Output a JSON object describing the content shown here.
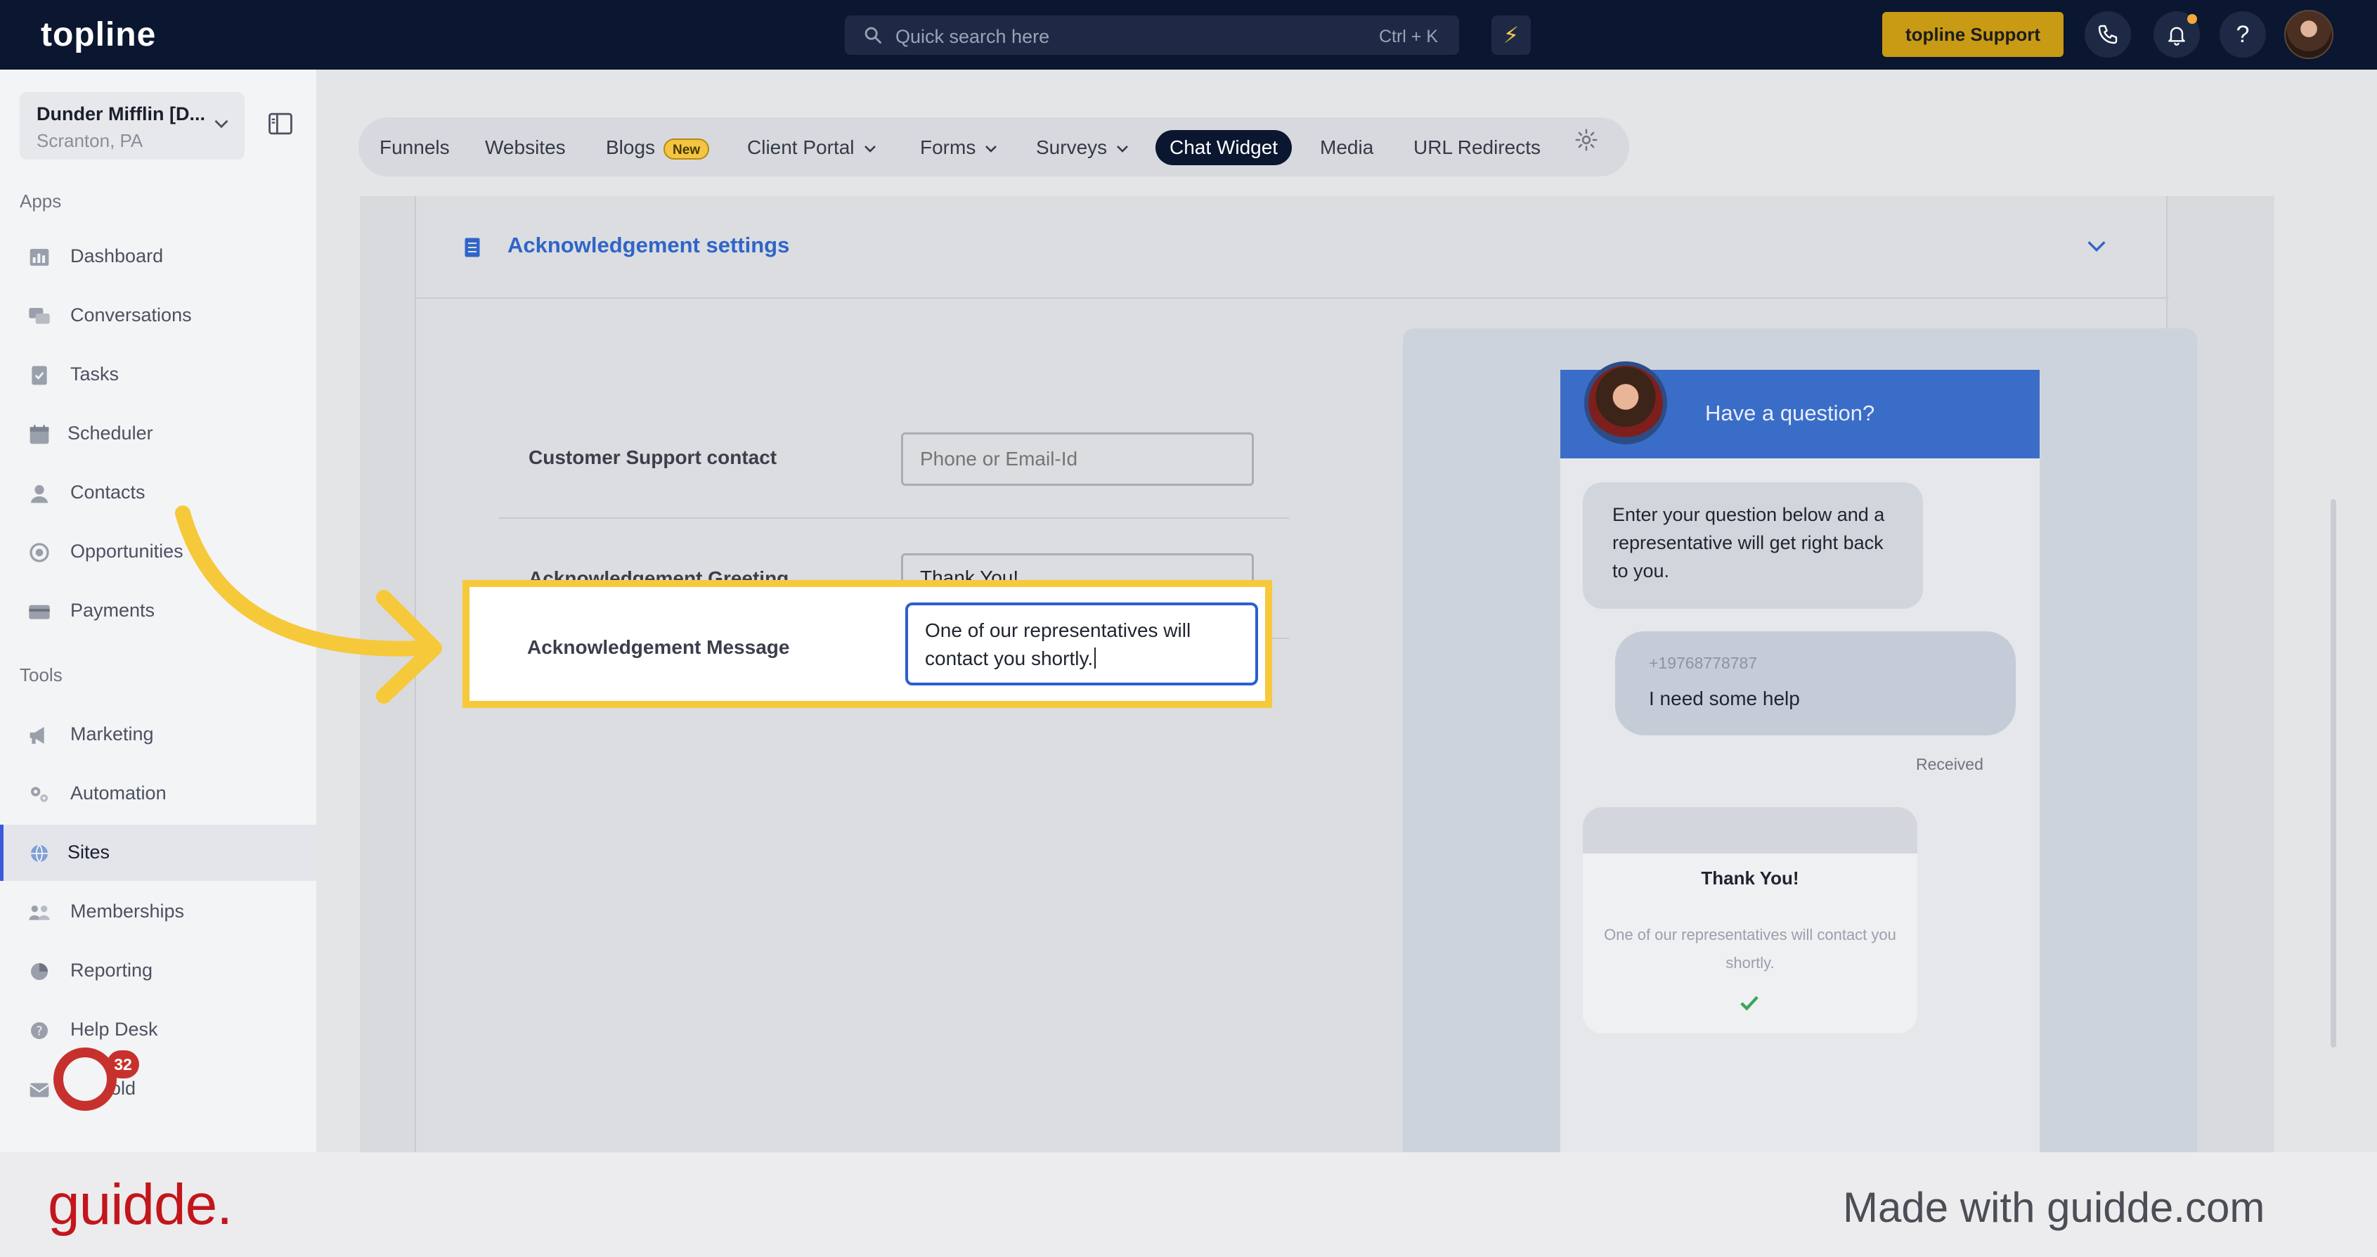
{
  "topbar": {
    "logo": "topline",
    "search_placeholder": "Quick search here",
    "search_shortcut": "Ctrl + K",
    "support_label": "topline Support",
    "help_label": "?",
    "colors": {
      "bg": "#0b1630",
      "support": "#c99a14"
    }
  },
  "sidebar": {
    "account_name": "Dunder Mifflin [D...",
    "account_location": "Scranton, PA",
    "apps_label": "Apps",
    "tools_label": "Tools",
    "apps": [
      {
        "label": "Dashboard",
        "icon": "dashboard-icon"
      },
      {
        "label": "Conversations",
        "icon": "chat-icon"
      },
      {
        "label": "Tasks",
        "icon": "task-icon"
      },
      {
        "label": "Scheduler",
        "icon": "calendar-icon"
      },
      {
        "label": "Contacts",
        "icon": "user-icon"
      },
      {
        "label": "Opportunities",
        "icon": "target-icon"
      },
      {
        "label": "Payments",
        "icon": "card-icon"
      }
    ],
    "tools": [
      {
        "label": "Marketing",
        "icon": "megaphone-icon"
      },
      {
        "label": "Automation",
        "icon": "gears-icon"
      },
      {
        "label": "Sites",
        "icon": "globe-icon",
        "active": true
      },
      {
        "label": "Memberships",
        "icon": "members-icon"
      },
      {
        "label": "Reporting",
        "icon": "pie-icon"
      },
      {
        "label": "Help Desk",
        "icon": "help-icon"
      },
      {
        "label": "Mailfold",
        "icon": "mail-icon"
      }
    ],
    "notification_count": "32"
  },
  "tabs": {
    "funnels": "Funnels",
    "websites": "Websites",
    "blogs": "Blogs",
    "blogs_badge": "New",
    "client_portal": "Client Portal",
    "forms": "Forms",
    "surveys": "Surveys",
    "chat_widget": "Chat Widget",
    "media": "Media",
    "url_redirects": "URL Redirects",
    "active": "Chat Widget"
  },
  "settings": {
    "title": "Acknowledgement settings",
    "support_label": "Customer Support contact",
    "support_placeholder": "Phone or Email-Id",
    "greeting_label": "Acknowledgement Greeting",
    "greeting_value": "Thank You!",
    "message_label": "Acknowledgement Message",
    "message_value_line1": "One of our representatives will",
    "message_value_line2": "contact you shortly."
  },
  "preview": {
    "header_title": "Have a question?",
    "intro_message": "Enter your question below and a representative will get right back to you.",
    "user_phone": "+19768778787",
    "user_message": "I need some help",
    "status": "Received",
    "ack_title": "Thank You!",
    "ack_message": "One of our representatives will contact you shortly.",
    "colors": {
      "header": "#3a6dc7"
    }
  },
  "footer": {
    "brand": "guidde.",
    "tagline": "Made with guidde.com"
  }
}
